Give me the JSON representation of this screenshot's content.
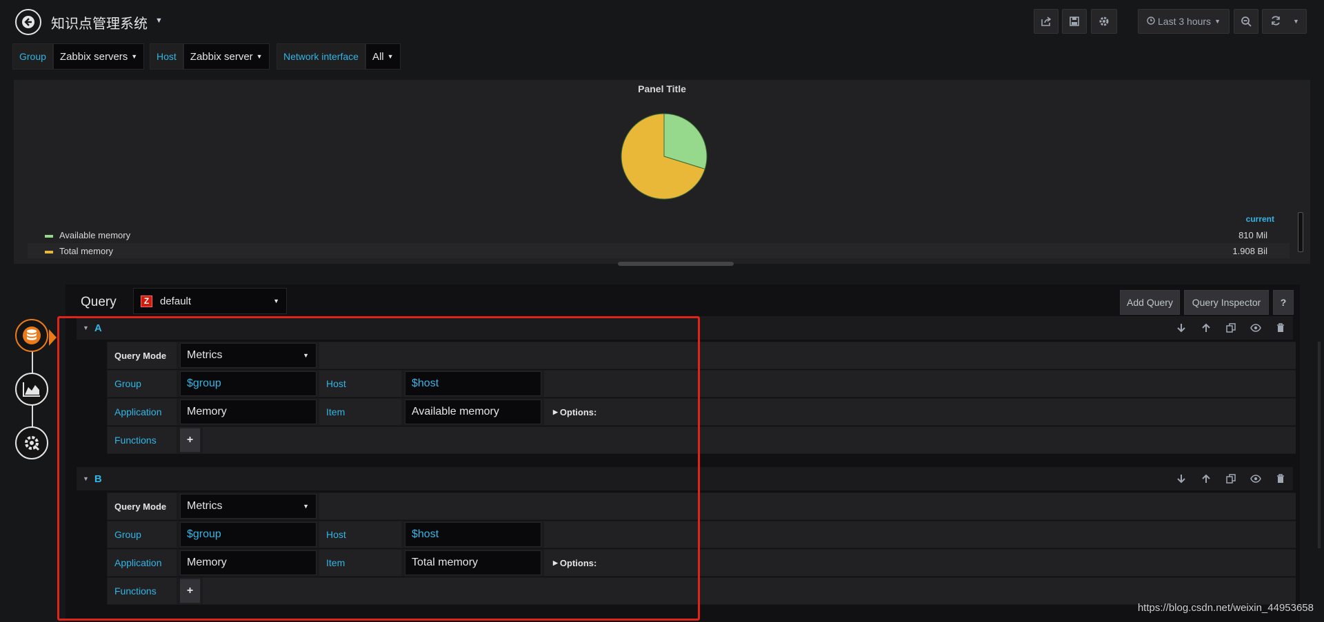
{
  "nav": {
    "title": "知识点管理系统",
    "time_range": "Last 3 hours"
  },
  "variables": [
    {
      "label": "Group",
      "value": "Zabbix servers"
    },
    {
      "label": "Host",
      "value": "Zabbix server"
    },
    {
      "label": "Network interface",
      "value": "All"
    }
  ],
  "panel": {
    "title": "Panel Title",
    "legend_header": "current",
    "legend": [
      {
        "name": "Available memory",
        "value": "810 Mil",
        "color": "#96d98d"
      },
      {
        "name": "Total memory",
        "value": "1.908 Bil",
        "color": "#eab839"
      }
    ]
  },
  "chart_data": {
    "type": "pie",
    "title": "Panel Title",
    "slices": [
      {
        "label": "Available memory",
        "display": "810 Mil",
        "value": 810000000,
        "color": "#96d98d"
      },
      {
        "label": "Total memory",
        "display": "1.908 Bil",
        "value": 1908000000,
        "color": "#eab839"
      }
    ]
  },
  "editor": {
    "heading": "Query",
    "datasource": "default",
    "datasource_logo": "Z",
    "add_query": "Add Query",
    "query_inspector": "Query Inspector",
    "help": "?"
  },
  "queries": [
    {
      "ref": "A",
      "mode_label": "Query Mode",
      "mode": "Metrics",
      "group_label": "Group",
      "group": "$group",
      "host_label": "Host",
      "host": "$host",
      "application_label": "Application",
      "application": "Memory",
      "item_label": "Item",
      "item": "Available memory",
      "options_label": "Options:",
      "functions_label": "Functions"
    },
    {
      "ref": "B",
      "mode_label": "Query Mode",
      "mode": "Metrics",
      "group_label": "Group",
      "group": "$group",
      "host_label": "Host",
      "host": "$host",
      "application_label": "Application",
      "application": "Memory",
      "item_label": "Item",
      "item": "Total memory",
      "options_label": "Options:",
      "functions_label": "Functions"
    }
  ],
  "watermark": "https://blog.csdn.net/weixin_44953658",
  "colors": {
    "accent": "#33b5e5",
    "active": "#eb7b18",
    "highlight": "#e0241a"
  }
}
